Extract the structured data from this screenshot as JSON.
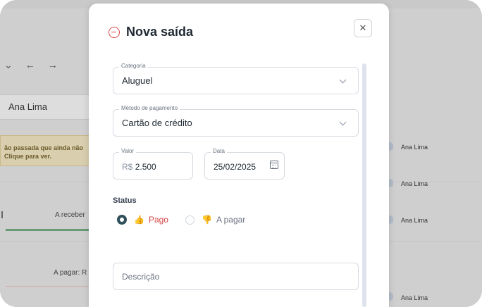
{
  "background": {
    "person_name": "Ana Lima",
    "warning_line1": "ão passada que ainda não",
    "warning_line2": "Clique para ver.",
    "receber_label": "A receber",
    "pagar_label": "A pagar:",
    "pagar_suffix": "R",
    "side_names": [
      "Ana Lima",
      "Ana Lima",
      "Ana Lima",
      "Ana Lima"
    ]
  },
  "modal": {
    "title": "Nova saída",
    "close_symbol": "✕",
    "categoria": {
      "label": "Categoria",
      "value": "Aluguel"
    },
    "metodo": {
      "label": "Método de pagamento",
      "value": "Cartão de crédito"
    },
    "valor": {
      "label": "Valor",
      "prefix": "R$",
      "value": "2.500"
    },
    "data": {
      "label": "Data",
      "value": "25/02/2025"
    },
    "status": {
      "label": "Status",
      "option_paid": "Pago",
      "option_unpaid": "A pagar",
      "selected": "Pago"
    },
    "descricao": {
      "placeholder": "Descrição"
    }
  },
  "colors": {
    "accent_red": "#d64545",
    "radio_selected": "#2f4f5b"
  }
}
